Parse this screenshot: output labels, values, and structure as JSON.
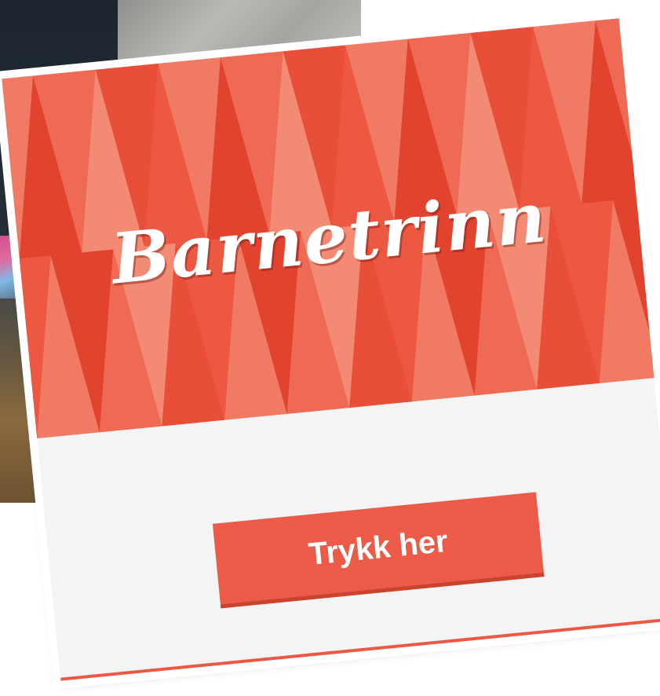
{
  "card": {
    "title": "Barnetrinn",
    "button_label": "Trykk her"
  },
  "colors": {
    "accent": "#ec5842",
    "accent_light": "#f07a63",
    "accent_dark": "#e1432f",
    "body_background": "#f4f4f4"
  }
}
